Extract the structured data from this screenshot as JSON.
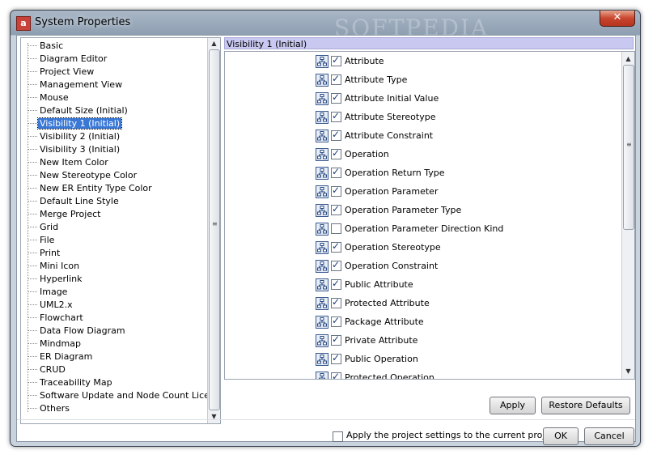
{
  "window": {
    "title": "System Properties",
    "app_icon": "app-logo-icon",
    "close": "✕",
    "watermark": "SOFTPEDIA"
  },
  "tree": {
    "items": [
      {
        "label": "Basic"
      },
      {
        "label": "Diagram Editor"
      },
      {
        "label": "Project View"
      },
      {
        "label": "Management View"
      },
      {
        "label": "Mouse"
      },
      {
        "label": "Default Size (Initial)"
      },
      {
        "label": "Visibility 1 (Initial)",
        "selected": true
      },
      {
        "label": "Visibility 2 (Initial)"
      },
      {
        "label": "Visibility 3 (Initial)"
      },
      {
        "label": "New Item Color"
      },
      {
        "label": "New Stereotype Color"
      },
      {
        "label": "New ER Entity Type Color"
      },
      {
        "label": "Default Line Style"
      },
      {
        "label": "Merge Project"
      },
      {
        "label": "Grid"
      },
      {
        "label": "File"
      },
      {
        "label": "Print"
      },
      {
        "label": "Mini Icon"
      },
      {
        "label": "Hyperlink"
      },
      {
        "label": "Image"
      },
      {
        "label": "UML2.x"
      },
      {
        "label": "Flowchart"
      },
      {
        "label": "Data Flow Diagram"
      },
      {
        "label": "Mindmap"
      },
      {
        "label": "ER Diagram"
      },
      {
        "label": "CRUD"
      },
      {
        "label": "Traceability Map"
      },
      {
        "label": "Software Update and Node Count License"
      },
      {
        "label": "Others"
      }
    ]
  },
  "panel": {
    "header": "Visibility 1 (Initial)",
    "options": [
      {
        "label": "Attribute",
        "checked": true
      },
      {
        "label": "Attribute Type",
        "checked": true
      },
      {
        "label": "Attribute Initial Value",
        "checked": true
      },
      {
        "label": "Attribute Stereotype",
        "checked": true
      },
      {
        "label": "Attribute Constraint",
        "checked": true
      },
      {
        "label": "Operation",
        "checked": true
      },
      {
        "label": "Operation Return Type",
        "checked": true
      },
      {
        "label": "Operation Parameter",
        "checked": true
      },
      {
        "label": "Operation Parameter Type",
        "checked": true
      },
      {
        "label": "Operation Parameter Direction Kind",
        "checked": false
      },
      {
        "label": "Operation Stereotype",
        "checked": true
      },
      {
        "label": "Operation Constraint",
        "checked": true
      },
      {
        "label": "Public Attribute",
        "checked": true
      },
      {
        "label": "Protected Attribute",
        "checked": true
      },
      {
        "label": "Package Attribute",
        "checked": true
      },
      {
        "label": "Private Attribute",
        "checked": true
      },
      {
        "label": "Public Operation",
        "checked": true
      },
      {
        "label": "Protected Operation",
        "checked": true
      }
    ],
    "apply_label": "Apply",
    "restore_label": "Restore Defaults"
  },
  "footer": {
    "apply_project_label": "Apply the project settings to the current project",
    "apply_project_checked": false,
    "ok_label": "OK",
    "cancel_label": "Cancel"
  },
  "colors": {
    "selection": "#3a78d6",
    "header_bg": "#c8c8f0"
  }
}
